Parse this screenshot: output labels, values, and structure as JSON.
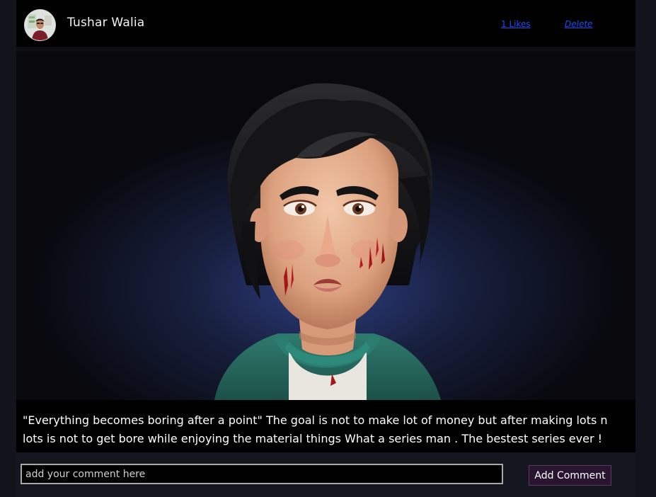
{
  "post": {
    "author": "Tushar Walia",
    "likes_label": "1 Likes",
    "delete_label": "Delete",
    "caption": "\"Everything becomes boring after a point\" The goal is not to make lot of money but after making lots n lots is not to get bore while enjoying the material things What a series man . The bestest series ever !"
  },
  "comment": {
    "placeholder": "add your comment here",
    "value": "",
    "submit_label": "Add Comment"
  },
  "colors": {
    "link": "#1b4cf5",
    "button_bg": "#2a1530",
    "page_bg": "#13131c"
  }
}
